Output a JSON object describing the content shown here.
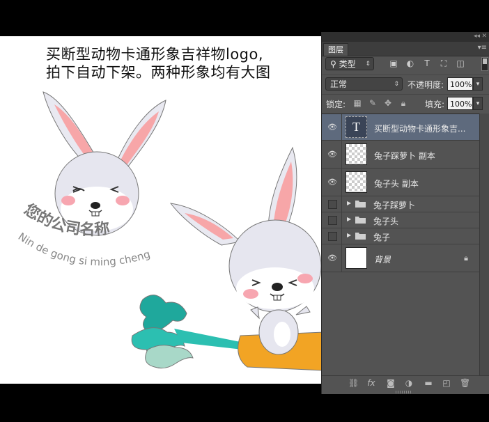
{
  "canvas": {
    "headline_line1": "买断型动物卡通形象吉祥物logo,",
    "headline_line2": "拍下自动下架。两种形象均有大图",
    "company_name_cn": "您的公司名称",
    "company_name_pinyin": "Nin de gong si ming cheng"
  },
  "panel": {
    "collapse_icon": "double-chevron-left-icon",
    "tab_label": "图层",
    "menu_icon": "panel-menu-icon",
    "filter": {
      "label": "类型",
      "icons": [
        "image-filter-icon",
        "adjustment-filter-icon",
        "type-filter-icon",
        "shape-filter-icon",
        "smart-object-filter-icon"
      ]
    },
    "blend_mode": "正常",
    "opacity_label": "不透明度:",
    "opacity_value": "100%",
    "lock_label": "锁定:",
    "lock_icons": [
      "lock-transparency-icon",
      "lock-image-icon",
      "lock-position-icon",
      "lock-all-icon"
    ],
    "fill_label": "填充:",
    "fill_value": "100%",
    "layers": [
      {
        "name": "买断型动物卡通形象吉...",
        "type": "text",
        "visible": true,
        "selected": true
      },
      {
        "name": "兔子踩萝卜 副本",
        "type": "pixel",
        "visible": true,
        "selected": false
      },
      {
        "name": "兔子头 副本",
        "type": "pixel",
        "visible": true,
        "selected": false
      },
      {
        "name": "兔子踩萝卜",
        "type": "group",
        "visible": false
      },
      {
        "name": "兔子头",
        "type": "group",
        "visible": false
      },
      {
        "name": "兔子",
        "type": "group",
        "visible": false
      },
      {
        "name": "背景",
        "type": "background",
        "visible": true,
        "locked": true
      }
    ],
    "footer_icons": [
      "link-layers-icon",
      "fx-icon",
      "layer-mask-icon",
      "adjustment-layer-icon",
      "new-group-icon",
      "new-layer-icon",
      "trash-icon"
    ],
    "footer_fx": "fx"
  },
  "colors": {
    "panel_bg": "#535353",
    "selected_layer": "#5e6a7d",
    "rabbit_ear_inner": "#f7a6a8",
    "carrot": "#f2a424",
    "leaf": "#1fa89c"
  }
}
